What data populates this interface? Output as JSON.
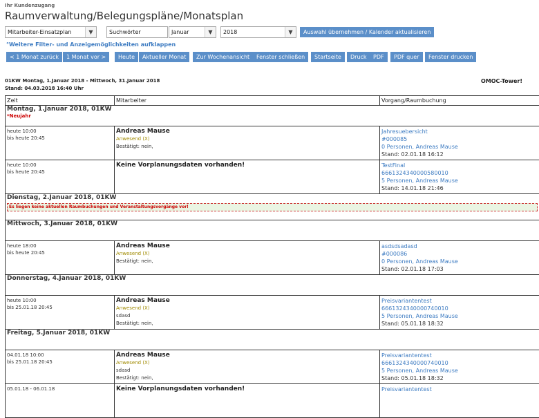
{
  "header": {
    "kundenzugang": "Ihr Kundenzugang",
    "title": "Raumverwaltung/Belegungspläne/Monatsplan"
  },
  "filters": {
    "plan": "Mitarbeiter-Einsatzplan",
    "search_value": "Suchwörter",
    "month": "Januar",
    "year": "2018",
    "apply_label": "Auswahl übernehmen / Kalender aktualisieren",
    "more_filters": "°Weitere Filter- und Anzeigemöglichkeiten aufklappen"
  },
  "toolbar": [
    "< 1 Monat zurück",
    "1 Monat vor >",
    "Heute",
    "Aktueller Monat",
    "Zur Wochenansicht",
    "Fenster schließen",
    "Startseite",
    "Druck",
    "PDF",
    "PDF quer",
    "Fenster drucken"
  ],
  "info": {
    "range": "01KW Montag, 1.Januar 2018 - Mittwoch, 31.Januar 2018",
    "stand": "Stand: 04.03.2018 16:40 Uhr",
    "location": "OMOC-Tower!"
  },
  "table": {
    "headers": [
      "Zeit",
      "Mitarbeiter",
      "Vorgang/Raumbuchung"
    ],
    "days": [
      {
        "label": "Montag, 1.Januar 2018, 01KW",
        "holiday": "*Neujahr",
        "entries": [
          {
            "time1": "heute 10:00",
            "time2": "bis heute 20:45",
            "name": "Andreas Mause",
            "status": "Anwesend (X)",
            "note": "",
            "confirmed": "Bestätigt: nein,",
            "vorgang": "Jahresuebersicht",
            "nr": "#000085",
            "persons": "0 Personen, Andreas Mause",
            "stand": "Stand: 02.01.18 16:12"
          },
          {
            "time1": "heute 10:00",
            "time2": "bis heute 20:45",
            "name": "Keine Vorplanungsdaten vorhanden!",
            "status": "",
            "note": "",
            "confirmed": "",
            "vorgang": "TestFinal",
            "nr": "6661324340000580010",
            "persons": "5 Personen, Andreas Mause",
            "stand": "Stand: 14.01.18 21:46"
          }
        ]
      },
      {
        "label": "Dienstag, 2.Januar 2018, 01KW",
        "holiday": "",
        "alert": "Es liegen keine aktuellen Raumbuchungen und Veranstaltungsvorgänge vor!",
        "entries": []
      },
      {
        "label": "Mittwoch, 3.Januar 2018, 01KW",
        "holiday": "",
        "entries": [
          {
            "time1": "heute 18:00",
            "time2": "bis heute 20:45",
            "name": "Andreas Mause",
            "status": "Anwesend (X)",
            "note": "",
            "confirmed": "Bestätigt: nein,",
            "vorgang": "asdsdsadasd",
            "nr": "#000086",
            "persons": "0 Personen, Andreas Mause",
            "stand": "Stand: 02.01.18 17:03"
          }
        ]
      },
      {
        "label": "Donnerstag, 4.Januar 2018, 01KW",
        "holiday": "",
        "entries": [
          {
            "time1": "heute 10:00",
            "time2": "bis 25.01.18 20:45",
            "name": "Andreas Mause",
            "status": "Anwesend (X)",
            "note": "sdasd",
            "confirmed": "Bestätigt: nein,",
            "vorgang": "Preisvariantentest",
            "nr": "6661324340000740010",
            "persons": "5 Personen, Andreas Mause",
            "stand": "Stand: 05.01.18 18:32"
          }
        ]
      },
      {
        "label": "Freitag, 5.Januar 2018, 01KW",
        "holiday": "",
        "entries": [
          {
            "time1": "04.01.18 10:00",
            "time2": "bis 25.01.18 20:45",
            "name": "Andreas Mause",
            "status": "Anwesend (X)",
            "note": "sdasd",
            "confirmed": "Bestätigt: nein,",
            "vorgang": "Preisvariantentest",
            "nr": "6661324340000740010",
            "persons": "5 Personen, Andreas Mause",
            "stand": "Stand: 05.01.18 18:32"
          },
          {
            "time1": "05.01.18 - 06.01.18",
            "time2": "",
            "name": "Keine Vorplanungsdaten vorhanden!",
            "status": "",
            "note": "",
            "confirmed": "",
            "vorgang": "Preisvariantentest",
            "nr": "",
            "persons": "",
            "stand": ""
          }
        ]
      }
    ]
  }
}
